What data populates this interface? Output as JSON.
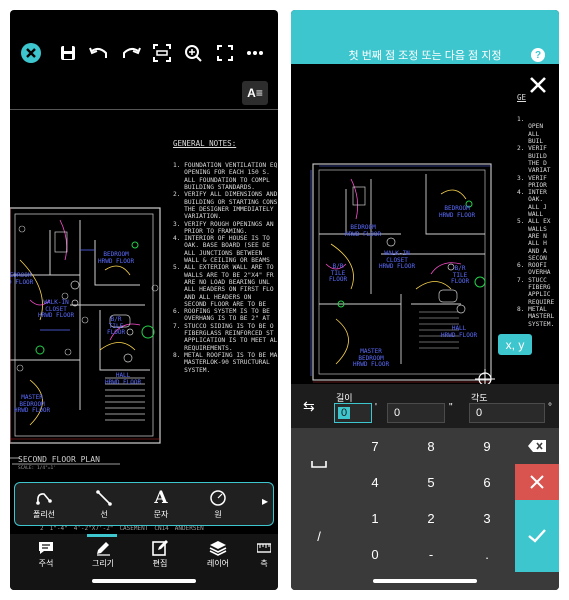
{
  "left": {
    "toolbar": {
      "close_icon": "close-icon",
      "save_icon": "save-icon",
      "undo_icon": "undo-icon",
      "redo_icon": "redo-icon",
      "crop_icon": "frame-icon",
      "zoom_icon": "zoom-search-icon",
      "fullscreen_icon": "fullscreen-icon",
      "more_icon": "more-icon",
      "text_style_icon": "text-style-icon"
    },
    "general_notes": {
      "title": "GENERAL NOTES:",
      "lines": [
        "1. FOUNDATION VENTILATION EQ",
        "   OPENING FOR EACH 150 S.",
        "   ALL FOUNDATION TO COMPL",
        "   BUILDING STANDARDS.",
        "2. VERIFY ALL DIMENSIONS AND",
        "   BUILDING OR STARTING CONS",
        "   THE DESIGNER IMMEDIATELY",
        "   VARIATION.",
        "3. VERIFY ROUGH OPENINGS AN",
        "   PRIOR TO FRAMING.",
        "4. INTERIOR OF HOUSE IS TO",
        "   OAK. BASE BOARD (SEE DE",
        "   ALL JUNCTIONS BETWEEN",
        "   WALL & CEILING OR BEAMS",
        "5. ALL EXTERIOR WALL ARE TO",
        "   WALLS ARE TO BE 2\"X4\" FR",
        "   ARE NO LOAD BEARING UNL",
        "   ALL HEADERS ON FIRST FLO",
        "   AND ALL HEADERS ON",
        "   SECOND FLOOR ARE TO BE",
        "6. ROOFING SYSTEM IS TO BE",
        "   OVERHANG IS TO BE 2\" AT",
        "7. STUCCO SIDING IS TO BE O",
        "   FIBERGLASS REINFORCED ST",
        "   APPLICATION IS TO MEET AL",
        "   REQUIREMENTS.",
        "8. METAL ROOFING IS TO BE MA",
        "   MASTERLOK-90 STRUCTURAL",
        "   SYSTEM."
      ]
    },
    "rooms": {
      "bedroom_a": "BEDROOM\nHRWD FLOOR",
      "bedroom_b": "EDROOM\nD FLOOR",
      "walkin_closet": "WALK-IN\nCLOSET\nHRWD FLOOR",
      "bath": "B/R\nTILE\nFLOOR",
      "hall": "HALL\nHRWD FLOOR",
      "master_bedroom": "MASTER\nBEDROOM\nHRWD FLOOR"
    },
    "plan_title": "SECOND FLOOR PLAN",
    "plan_scale": "SCALE: 1/4\"=1'",
    "tools": [
      {
        "label": "폴리선",
        "icon": "polyline-icon"
      },
      {
        "label": "선",
        "icon": "line-icon"
      },
      {
        "label": "문자",
        "icon": "text-icon"
      },
      {
        "label": "원",
        "icon": "circle-icon"
      }
    ],
    "table_strip": [
      "2",
      "1\"-4\"",
      "4'-2\"X7'-2\"",
      "CASEMENT",
      "CN14",
      "ANDERSEN"
    ],
    "nav": [
      {
        "label": "주석",
        "icon": "comment-icon"
      },
      {
        "label": "그리기",
        "icon": "pencil-icon"
      },
      {
        "label": "편집",
        "icon": "edit-icon"
      },
      {
        "label": "레이어",
        "icon": "layers-icon"
      },
      {
        "label": "측",
        "icon": "measure-icon"
      }
    ]
  },
  "right": {
    "header_title": "첫 번째 점 조정 또는 다음 점 지정",
    "help_icon": "help-icon",
    "close_icon": "close-icon",
    "general_notes": {
      "title": "GE",
      "lines": [
        "1.",
        "   OPEN",
        "   ALL",
        "   BUIL",
        "2. VERIF",
        "   BUILD",
        "   THE D",
        "   VARIAT",
        "3. VERIF",
        "   PRIOR",
        "4. INTER",
        "   OAK.",
        "   ALL J",
        "   WALL",
        "5. ALL EX",
        "   WALLS",
        "   ARE N",
        "   ALL H",
        "   AND A",
        "   SECON",
        "6. ROOFI",
        "   OVERHA",
        "7. STUCC",
        "   FIBERG",
        "   APPLIC",
        "   REQUIRE",
        "8. METAL",
        "   MASTERL",
        "   SYSTEM."
      ]
    },
    "rooms": {
      "bedroom_a": "BEDROOM\nHRWD FLOOR",
      "bedroom_b": "BEDROOM\nHRWD FLOOR",
      "walkin_closet": "WALK-IN\nCLOSET\nHRWD FLOOR",
      "bath": "B/R\nTILE\nFLOOR",
      "bath2": "B/R\nTILE\nFLOOR",
      "hall": "HALL\nHRWD FLOOR",
      "master_bedroom": "MASTER\nBEDROOM\nHRWD FLOOR"
    },
    "xy_button": "x, y",
    "length_label": "길이",
    "angle_label": "각도",
    "length_value_ft": "0",
    "length_unit_ft": "'",
    "length_value_in": "0",
    "length_unit_in": "\"",
    "angle_value": "0",
    "angle_unit": "°",
    "keys": [
      "7",
      "8",
      "9",
      "4",
      "5",
      "6",
      "1",
      "2",
      "3",
      "0",
      "-",
      "."
    ],
    "space_key": "␣",
    "slash_key": "/",
    "swap_icon": "swap-arrows-icon",
    "backspace_icon": "backspace-icon",
    "cancel_icon": "cancel-x-icon",
    "confirm_icon": "checkmark-icon",
    "colors": {
      "teal": "#3ec6cf",
      "cancel_red": "#d9534f",
      "keypad_bg": "#3a3a3a"
    }
  }
}
